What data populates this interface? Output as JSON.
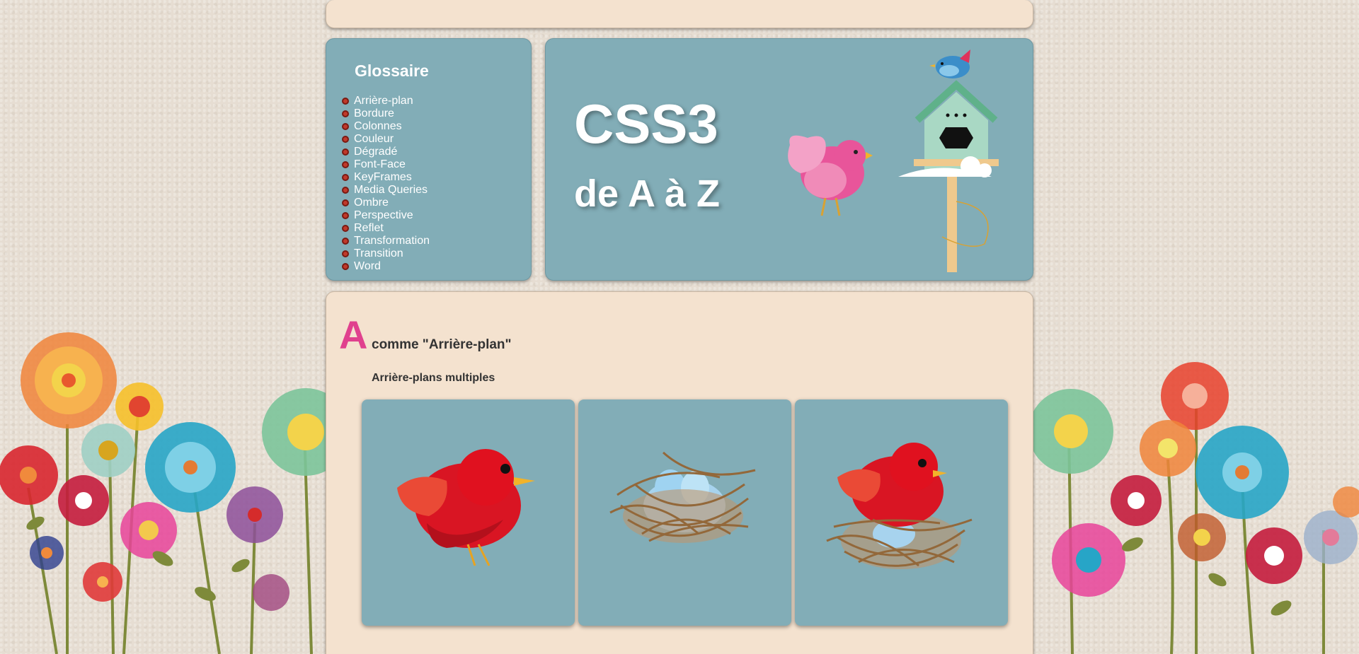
{
  "glossary": {
    "title": "Glossaire",
    "items": [
      {
        "label": "Arrière-plan"
      },
      {
        "label": "Bordure"
      },
      {
        "label": "Colonnes"
      },
      {
        "label": "Couleur"
      },
      {
        "label": "Dégradé"
      },
      {
        "label": "Font-Face"
      },
      {
        "label": "KeyFrames"
      },
      {
        "label": "Media Queries"
      },
      {
        "label": "Ombre"
      },
      {
        "label": "Perspective"
      },
      {
        "label": "Reflet"
      },
      {
        "label": "Transformation"
      },
      {
        "label": "Transition"
      },
      {
        "label": "Word"
      }
    ]
  },
  "hero": {
    "title": "CSS3",
    "subtitle": "de A à Z"
  },
  "section": {
    "letter": "A",
    "title": "comme \"Arrière-plan\"",
    "subsection": "Arrière-plans multiples"
  },
  "tiles": [
    {
      "icon": "red-bird-image"
    },
    {
      "icon": "nest-with-eggs-image"
    },
    {
      "icon": "bird-in-nest-image"
    }
  ],
  "colors": {
    "panel_blue": "#82adb7",
    "panel_cream": "#f4e2cf",
    "accent_pink": "#e0418e",
    "bullet_red": "#c0392b"
  }
}
